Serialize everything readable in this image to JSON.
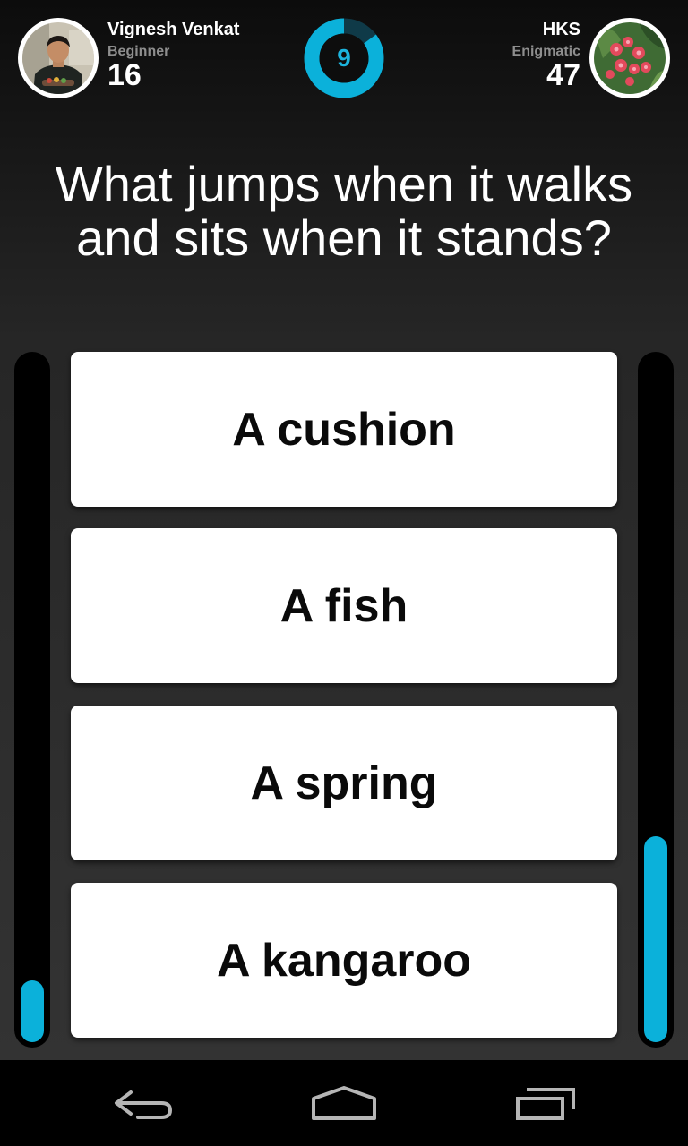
{
  "player_left": {
    "name": "Vignesh Venkat",
    "rank": "Beginner",
    "score": "16",
    "score_bar_level": 0.09,
    "avatar_icon": "person-photo"
  },
  "player_right": {
    "name": "HKS",
    "rank": "Enigmatic",
    "score": "47",
    "score_bar_level": 0.3,
    "avatar_icon": "flower-photo"
  },
  "timer": {
    "seconds_left": "9",
    "progress": 0.85
  },
  "question": "What jumps when it walks and sits when it stands?",
  "answers": [
    "A cushion",
    "A fish",
    "A spring",
    "A kangaroo"
  ],
  "navbar": {
    "back_icon": "back-arrow-icon",
    "home_icon": "home-icon",
    "recent_icon": "recent-apps-icon"
  },
  "colors": {
    "accent": "#0bb1da",
    "timer_track": "#0f3a48",
    "rank_text": "#8e8e8e",
    "card": "#ffffff"
  }
}
